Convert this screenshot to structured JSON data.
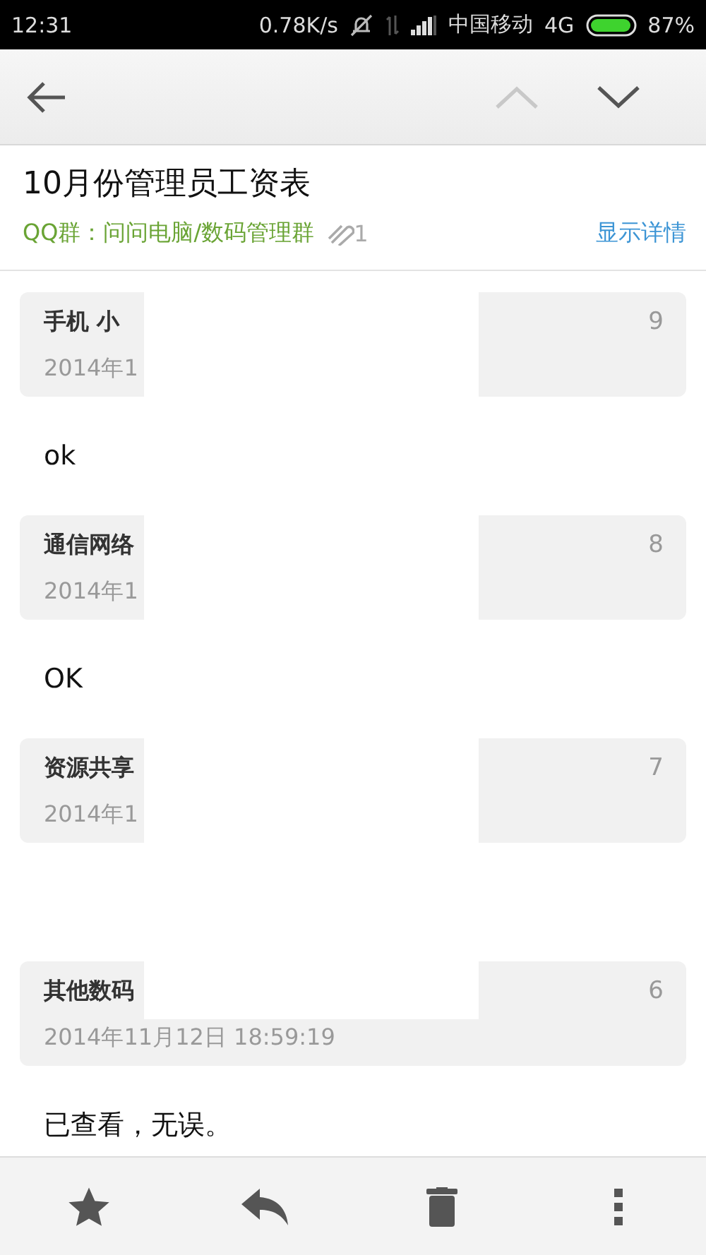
{
  "status_bar": {
    "time": "12:31",
    "speed": "0.78K/s",
    "carrier": "中国移动",
    "network": "4G",
    "battery": "87%"
  },
  "toolbar": {
    "buttons": [
      {
        "kind": "back",
        "disabled": false
      },
      {
        "kind": "up",
        "disabled": true
      },
      {
        "kind": "down",
        "disabled": false
      }
    ]
  },
  "header": {
    "subject": "10月份管理员工资表",
    "group": "QQ群：问问电脑/数码管理群",
    "attachments": "1",
    "details_link": "显示详情"
  },
  "messages": [
    {
      "sender": "手机 小",
      "date": "2014年1",
      "number": "9",
      "body": "ok"
    },
    {
      "sender": "通信网络",
      "date": "2014年1",
      "number": "8",
      "body": "OK"
    },
    {
      "sender": "资源共享",
      "date": "2014年1",
      "number": "7"
    },
    {
      "sender": "其他数码",
      "date": "2014年11月12日 18:59:19",
      "number": "6",
      "body": "已查看，无误。"
    }
  ],
  "bottom_bar": [
    {
      "kind": "star"
    },
    {
      "kind": "reply"
    },
    {
      "kind": "delete"
    },
    {
      "kind": "more"
    }
  ]
}
